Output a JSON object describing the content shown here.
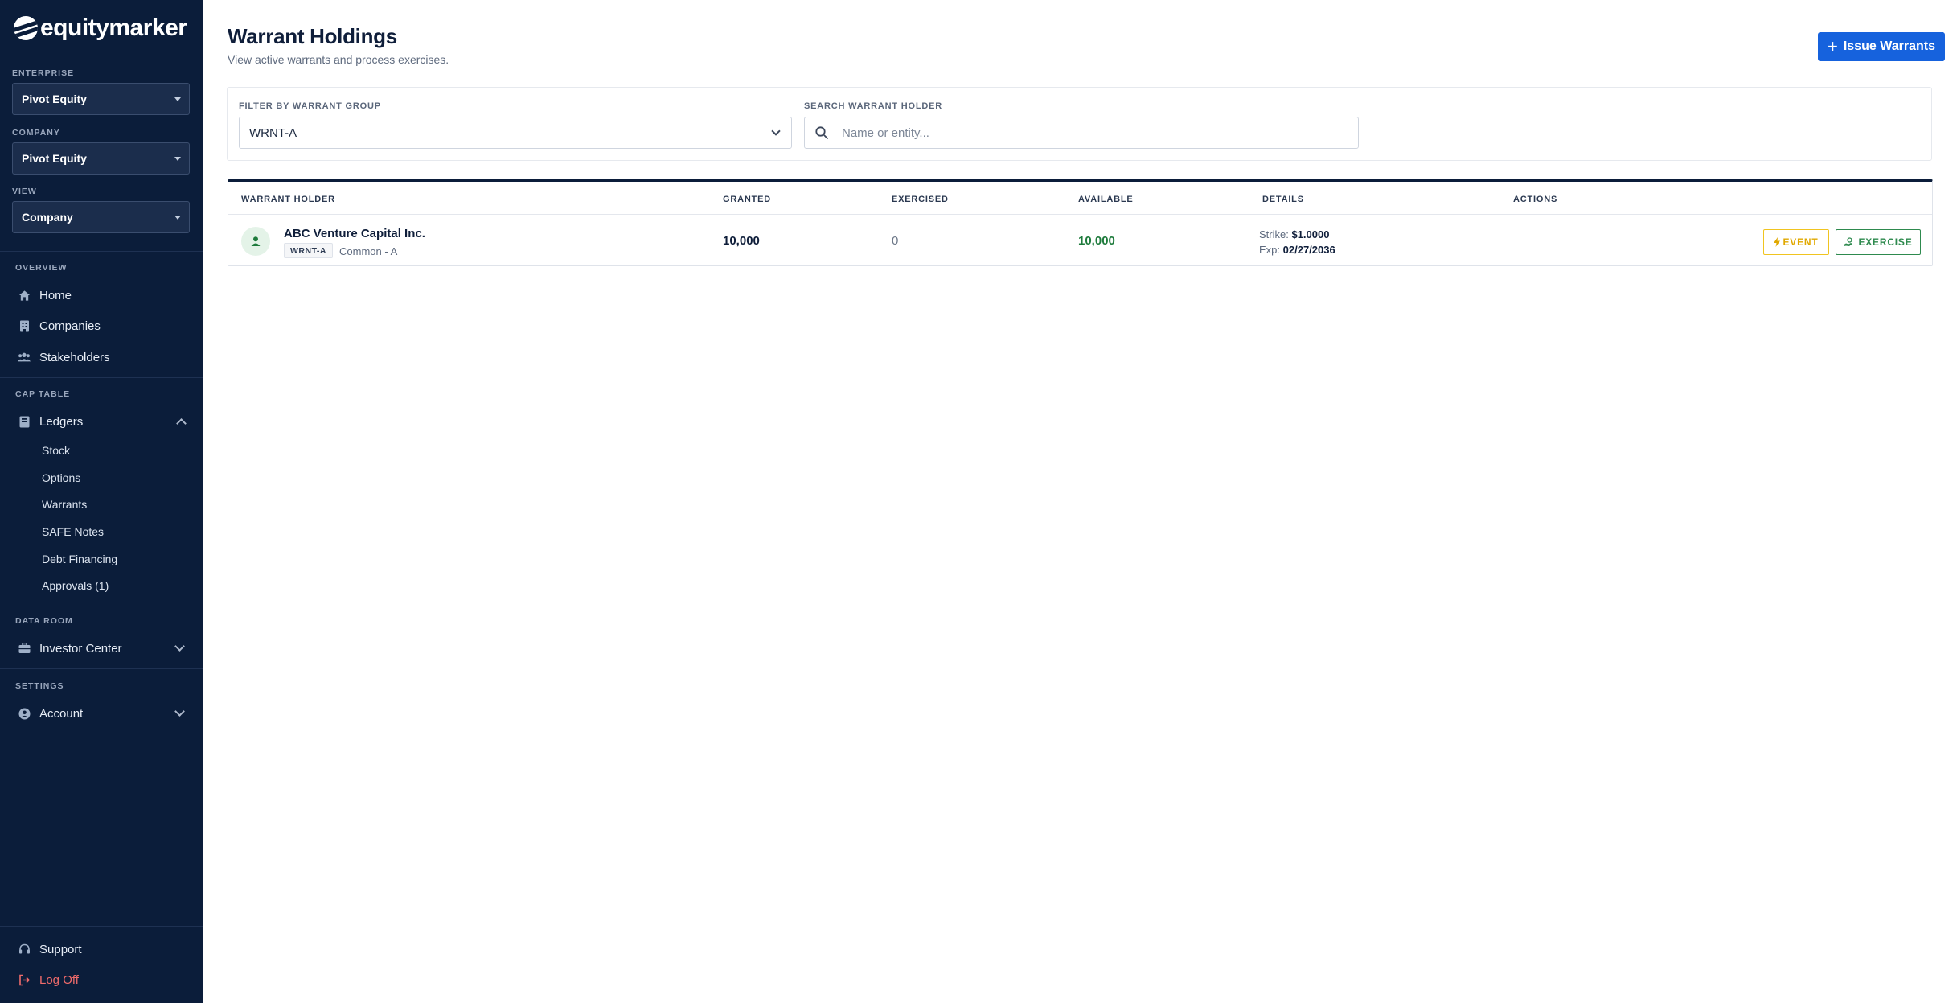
{
  "brand": {
    "name": "equitymarker",
    "icon": "equitymarker-logo-icon"
  },
  "sidebar": {
    "enterprise": {
      "label": "ENTERPRISE",
      "value": "Pivot Equity"
    },
    "company": {
      "label": "COMPANY",
      "value": "Pivot Equity"
    },
    "view": {
      "label": "VIEW",
      "value": "Company"
    },
    "sections": {
      "overview": "OVERVIEW",
      "cap_table": "CAP TABLE",
      "data_room": "DATA ROOM",
      "settings": "SETTINGS"
    },
    "nav": {
      "home": {
        "label": "Home",
        "icon": "home-icon"
      },
      "companies": {
        "label": "Companies",
        "icon": "building-icon"
      },
      "stakeholders": {
        "label": "Stakeholders",
        "icon": "users-icon"
      },
      "ledgers": {
        "label": "Ledgers",
        "icon": "book-icon",
        "expanded": true
      },
      "ledger_items": [
        "Stock",
        "Options",
        "Warrants",
        "SAFE Notes",
        "Debt Financing",
        "Approvals (1)"
      ],
      "investor_center": {
        "label": "Investor Center",
        "icon": "briefcase-icon"
      },
      "account": {
        "label": "Account",
        "icon": "user-circle-icon"
      },
      "support": {
        "label": "Support",
        "icon": "headset-icon"
      },
      "logoff": {
        "label": "Log Off",
        "icon": "logout-icon",
        "color": "#f06b6b"
      }
    }
  },
  "page": {
    "title": "Warrant Holdings",
    "subtitle": "View active warrants and process exercises.",
    "issue_button": "Issue Warrants"
  },
  "filters": {
    "group_label": "FILTER BY WARRANT GROUP",
    "group_value": "WRNT-A",
    "search_label": "SEARCH WARRANT HOLDER",
    "search_placeholder": "Name or entity..."
  },
  "table": {
    "headers": [
      "WARRANT HOLDER",
      "GRANTED",
      "EXERCISED",
      "AVAILABLE",
      "DETAILS",
      "ACTIONS"
    ],
    "rows": [
      {
        "holder": "ABC Venture Capital Inc.",
        "group": "WRNT-A",
        "class": "Common - A",
        "granted": "10,000",
        "exercised": "0",
        "available": "10,000",
        "strike_label": "Strike:",
        "strike": "$1.0000",
        "exp_label": "Exp:",
        "exp": "02/27/2036",
        "event_label": "EVENT",
        "exercise_label": "EXERCISE"
      }
    ]
  },
  "colors": {
    "sidebar_bg": "#0b1d3a",
    "primary": "#1662dd",
    "available_green": "#1e7b3c",
    "event_yellow": "#e0a800",
    "exercise_green": "#2e8a4e"
  }
}
